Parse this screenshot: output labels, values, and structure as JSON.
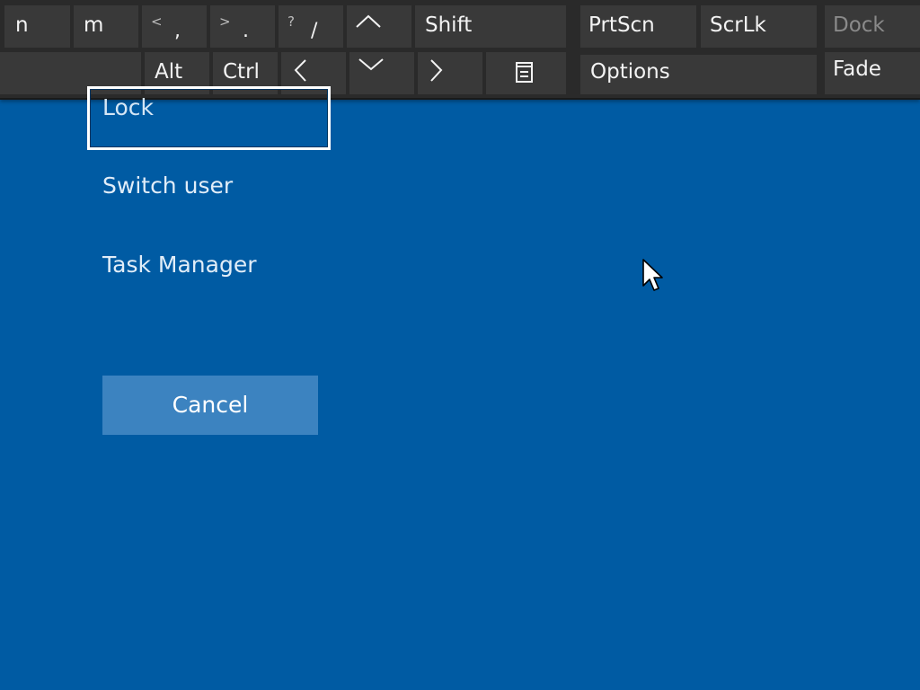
{
  "keyboard": {
    "row1": {
      "n": "n",
      "m": "m",
      "comma_shift": "<",
      "comma": ",",
      "period_shift": ">",
      "period": ".",
      "slash_shift": "?",
      "slash": "/",
      "shift": "Shift",
      "prtscn": "PrtScn",
      "scrlk": "ScrLk",
      "dock": "Dock"
    },
    "row2": {
      "alt": "Alt",
      "ctrl": "Ctrl",
      "options": "Options",
      "fade": "Fade"
    },
    "icons": {
      "up": "chevron-up-icon",
      "left": "chevron-left-icon",
      "down": "chevron-down-icon",
      "right": "chevron-right-icon",
      "menu": "context-menu-icon"
    }
  },
  "security_options": {
    "lock": "Lock",
    "switch_user": "Switch user",
    "task_manager": "Task Manager",
    "cancel": "Cancel"
  },
  "colors": {
    "background": "#005ba3",
    "keyboard_bg": "#2a2a2a",
    "key_bg": "#393939",
    "cancel_bg": "#3c83c0"
  }
}
